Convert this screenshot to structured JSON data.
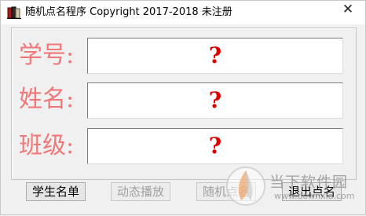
{
  "window": {
    "title": "随机点名程序 Copyright 2017-2018 未注册",
    "close_glyph": "✕"
  },
  "fields": [
    {
      "label": "学号:",
      "value": "?"
    },
    {
      "label": "姓名:",
      "value": "?"
    },
    {
      "label": "班级:",
      "value": "?"
    }
  ],
  "buttons": {
    "student_list": "学生名单",
    "animated_play": "动态播放",
    "random_call": "随机点名",
    "exit_call": "退出点名"
  },
  "watermark": {
    "text": "当下软件园",
    "url": "www.downxia.com"
  },
  "colors": {
    "label": "#f07878",
    "value": "#e00000",
    "background": "#f0f0f0"
  },
  "icons": {
    "app": "book-icon",
    "close": "close-icon",
    "watermark_logo": "downxia-logo-icon"
  }
}
